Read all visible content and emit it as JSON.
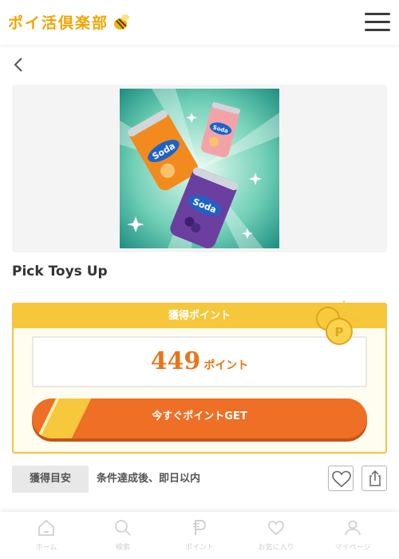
{
  "header": {
    "logo_text": "ポイ活倶楽部",
    "menu_icon": "hamburger-menu-icon"
  },
  "nav": {
    "back_icon": "chevron-left-icon"
  },
  "offer": {
    "image_icon": "soda-cans-promo-image",
    "title": "Pick Toys Up",
    "points_header": "獲得ポイント",
    "points_value": "449",
    "points_unit": "ポイント",
    "get_button_label": "今すぐポイントGET",
    "guide_tag": "獲得目安",
    "guide_text": "条件達成後、即日以内",
    "favorite_icon": "heart-icon",
    "share_icon": "share-icon"
  },
  "tabs": [
    {
      "label": "ホーム",
      "icon": "home-icon"
    },
    {
      "label": "検索",
      "icon": "search-icon"
    },
    {
      "label": "ポイント",
      "icon": "point-p-icon"
    },
    {
      "label": "お気に入り",
      "icon": "heart-icon"
    },
    {
      "label": "マイページ",
      "icon": "user-icon"
    }
  ],
  "colors": {
    "brand_yellow": "#f6c73a",
    "accent_orange": "#ee6f25",
    "points_text": "#e8751a"
  }
}
